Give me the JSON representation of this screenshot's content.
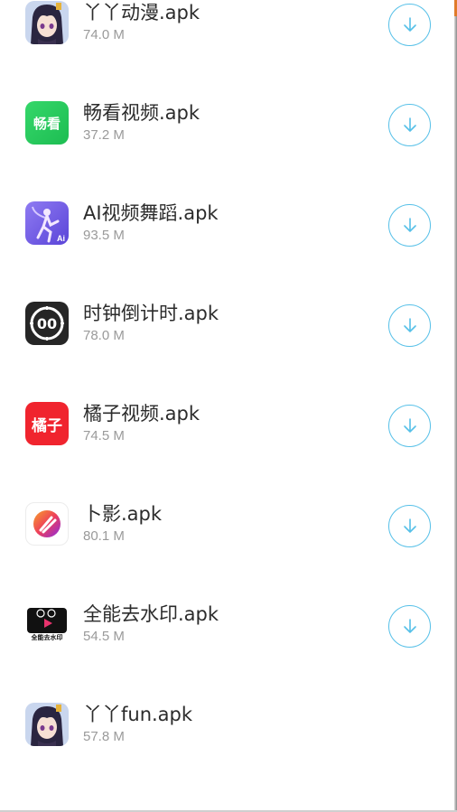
{
  "accent_color": "#56c0e8",
  "apps": [
    {
      "name": "丫丫动漫.apk",
      "size": "74.0 M",
      "icon": "anime-girl-icon",
      "has_download": true
    },
    {
      "name": "畅看视频.apk",
      "size": "37.2 M",
      "icon": "changkan-icon",
      "icon_text": "畅看",
      "has_download": true
    },
    {
      "name": "AI视频舞蹈.apk",
      "size": "93.5 M",
      "icon": "ai-dance-icon",
      "icon_text": "Ai",
      "has_download": true
    },
    {
      "name": "时钟倒计时.apk",
      "size": "78.0 M",
      "icon": "countdown-clock-icon",
      "icon_text": "00",
      "has_download": true
    },
    {
      "name": "橘子视频.apk",
      "size": "74.5 M",
      "icon": "juzi-icon",
      "icon_text": "橘子",
      "has_download": true
    },
    {
      "name": "卜影.apk",
      "size": "80.1 M",
      "icon": "buying-icon",
      "has_download": true
    },
    {
      "name": "全能去水印.apk",
      "size": "54.5 M",
      "icon": "watermark-remover-icon",
      "icon_text": "全能去水印",
      "has_download": true
    },
    {
      "name": "丫丫fun.apk",
      "size": "57.8 M",
      "icon": "anime-girl-icon",
      "has_download": false
    }
  ]
}
